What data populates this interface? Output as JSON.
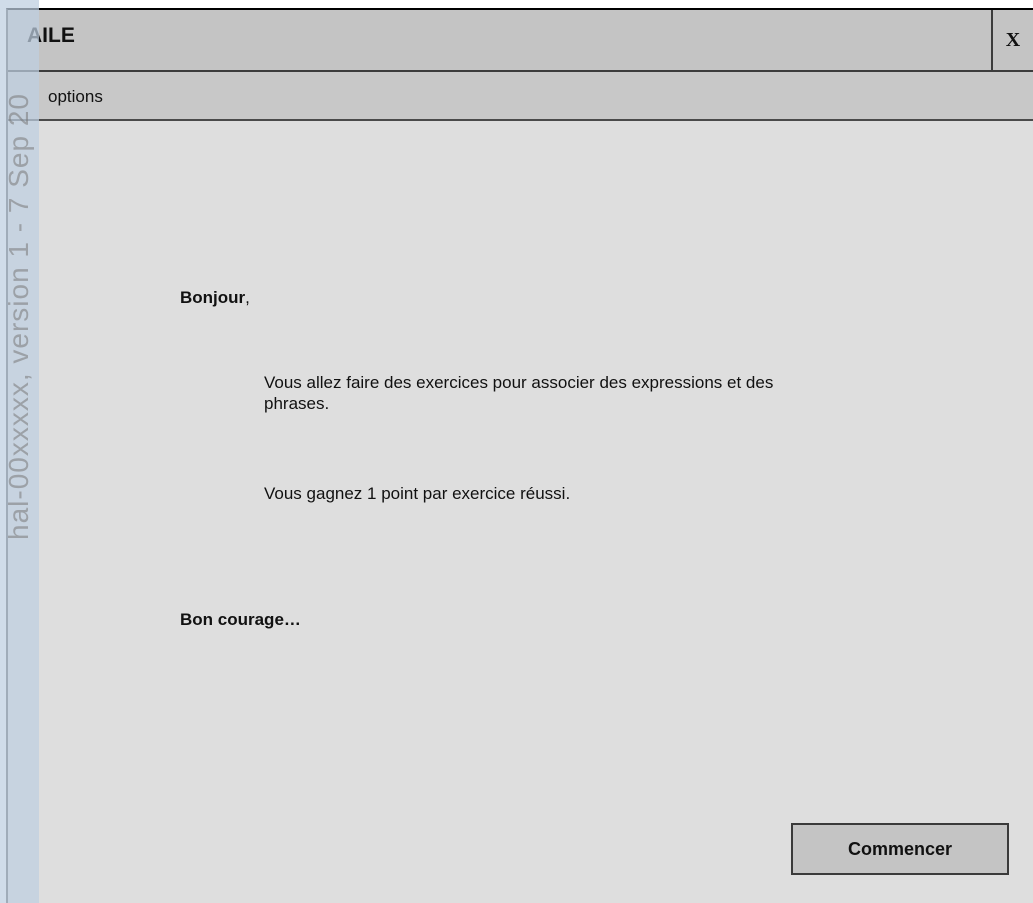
{
  "window": {
    "title": "AILE",
    "close_label": "X"
  },
  "menu": {
    "options_label": "options"
  },
  "content": {
    "greeting_bold": "Bonjour",
    "greeting_suffix": ",",
    "paragraph_1": "Vous allez faire des exercices pour associer des expressions et des phrases.",
    "paragraph_2": "Vous gagnez 1 point par exercice réussi.",
    "closing": "Bon courage…"
  },
  "actions": {
    "start_label": "Commencer"
  },
  "watermark": {
    "text": "hal-00xxxxx, version 1 - 7 Sep 20"
  },
  "colors": {
    "titlebar_bg": "#c4c4c4",
    "content_bg": "#dedede",
    "border": "#3c3c3c",
    "watermark_strip": "#becee0"
  }
}
